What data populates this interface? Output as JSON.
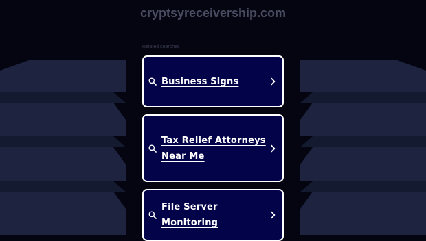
{
  "header": {
    "domain": "cryptsyreceivership.com"
  },
  "related": {
    "label": "Related searches",
    "items": [
      {
        "label": "Business Signs",
        "icon": "search-icon",
        "arrow": "chevron-right-icon"
      },
      {
        "label": "Tax Relief Attorneys Near Me",
        "icon": "search-icon",
        "arrow": "chevron-right-icon"
      },
      {
        "label": "File Server Monitoring",
        "icon": "search-icon",
        "arrow": "chevron-right-icon"
      }
    ]
  },
  "colors": {
    "background": "#050512",
    "tile_background": "#03034a",
    "tile_border": "#ffffff",
    "text": "#ffffff",
    "domain_text": "#4a4d61",
    "decoration": "#1e2440"
  }
}
